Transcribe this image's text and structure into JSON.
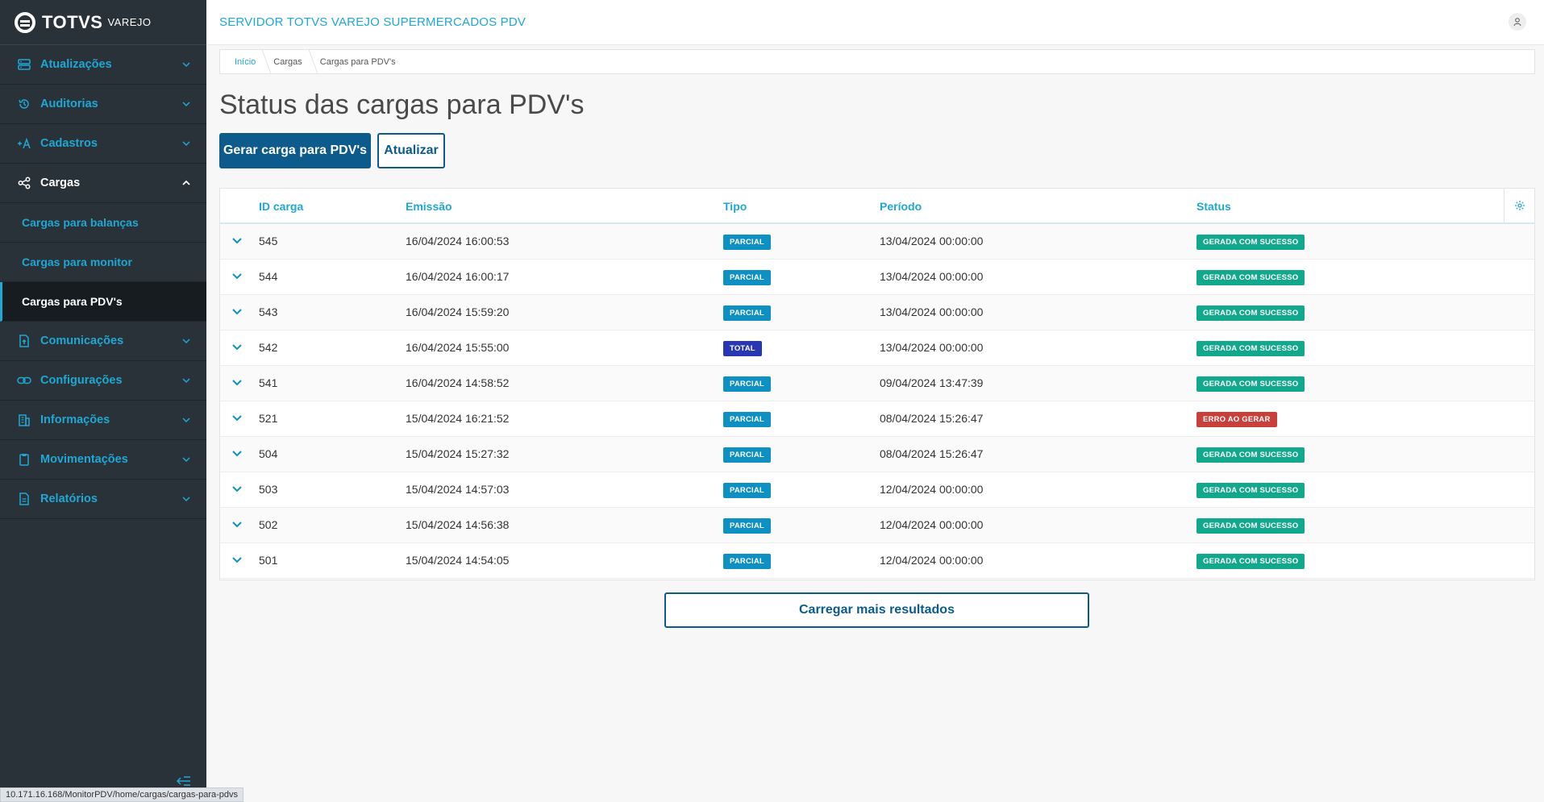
{
  "sidebar": {
    "logo_text": "TOTVS",
    "logo_sub": "VAREJO",
    "items": [
      {
        "label": "Atualizações",
        "icon": "server-icon"
      },
      {
        "label": "Auditorias",
        "icon": "history-icon"
      },
      {
        "label": "Cadastros",
        "icon": "add-user-icon"
      },
      {
        "label": "Cargas",
        "icon": "share-icon",
        "open": true,
        "children": [
          {
            "label": "Cargas para balanças"
          },
          {
            "label": "Cargas para monitor"
          },
          {
            "label": "Cargas para PDV's",
            "active": true
          }
        ]
      },
      {
        "label": "Comunicações",
        "icon": "file-upload-icon"
      },
      {
        "label": "Configurações",
        "icon": "link-icon"
      },
      {
        "label": "Informações",
        "icon": "building-icon"
      },
      {
        "label": "Movimentações",
        "icon": "clipboard-icon"
      },
      {
        "label": "Relatórios",
        "icon": "document-icon"
      }
    ]
  },
  "header": {
    "title": "SERVIDOR TOTVS VAREJO SUPERMERCADOS PDV"
  },
  "breadcrumb": [
    "Início",
    "Cargas",
    "Cargas para PDV's"
  ],
  "page": {
    "title": "Status das cargas para PDV's",
    "primary_button": "Gerar carga para PDV's",
    "secondary_button": "Atualizar",
    "load_more": "Carregar mais resultados"
  },
  "table": {
    "columns": [
      "ID carga",
      "Emissão",
      "Tipo",
      "Período",
      "Status"
    ],
    "rows": [
      {
        "id": "545",
        "emissao": "16/04/2024 16:00:53",
        "tipo": "PARCIAL",
        "periodo": "13/04/2024 00:00:00",
        "status": "GERADA COM SUCESSO"
      },
      {
        "id": "544",
        "emissao": "16/04/2024 16:00:17",
        "tipo": "PARCIAL",
        "periodo": "13/04/2024 00:00:00",
        "status": "GERADA COM SUCESSO"
      },
      {
        "id": "543",
        "emissao": "16/04/2024 15:59:20",
        "tipo": "PARCIAL",
        "periodo": "13/04/2024 00:00:00",
        "status": "GERADA COM SUCESSO"
      },
      {
        "id": "542",
        "emissao": "16/04/2024 15:55:00",
        "tipo": "TOTAL",
        "periodo": "13/04/2024 00:00:00",
        "status": "GERADA COM SUCESSO"
      },
      {
        "id": "541",
        "emissao": "16/04/2024 14:58:52",
        "tipo": "PARCIAL",
        "periodo": "09/04/2024 13:47:39",
        "status": "GERADA COM SUCESSO"
      },
      {
        "id": "521",
        "emissao": "15/04/2024 16:21:52",
        "tipo": "PARCIAL",
        "periodo": "08/04/2024 15:26:47",
        "status": "ERRO AO GERAR"
      },
      {
        "id": "504",
        "emissao": "15/04/2024 15:27:32",
        "tipo": "PARCIAL",
        "periodo": "08/04/2024 15:26:47",
        "status": "GERADA COM SUCESSO"
      },
      {
        "id": "503",
        "emissao": "15/04/2024 14:57:03",
        "tipo": "PARCIAL",
        "periodo": "12/04/2024 00:00:00",
        "status": "GERADA COM SUCESSO"
      },
      {
        "id": "502",
        "emissao": "15/04/2024 14:56:38",
        "tipo": "PARCIAL",
        "periodo": "12/04/2024 00:00:00",
        "status": "GERADA COM SUCESSO"
      },
      {
        "id": "501",
        "emissao": "15/04/2024 14:54:05",
        "tipo": "PARCIAL",
        "periodo": "12/04/2024 00:00:00",
        "status": "GERADA COM SUCESSO"
      }
    ]
  },
  "status_bar": {
    "url": "10.171.16.168/MonitorPDV/home/cargas/cargas-para-pdvs"
  },
  "colors": {
    "sidebar_bg": "#283238",
    "accent": "#20a7d3",
    "primary": "#0c5b8c",
    "tag_parcial": "#0e91c2",
    "tag_total": "#2937b4",
    "tag_success": "#12a88c",
    "tag_error": "#c9403a"
  }
}
